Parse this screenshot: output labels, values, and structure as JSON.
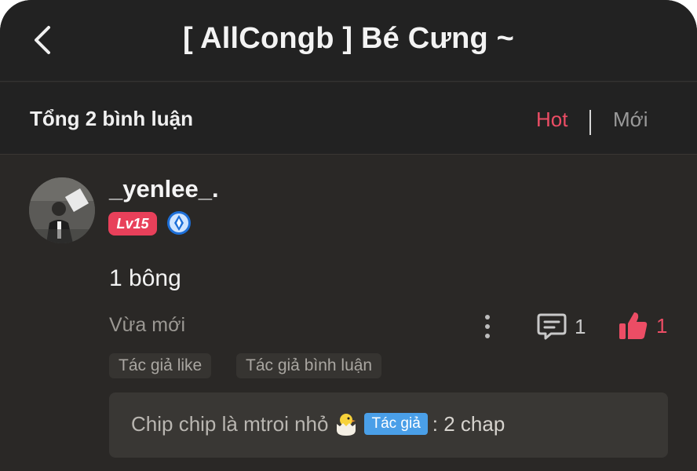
{
  "header": {
    "title": "[ AllCongb ] Bé Cưng ~",
    "back_icon": "chevron-left-icon"
  },
  "subbar": {
    "total_label": "Tổng 2 bình luận",
    "sort_hot": "Hot",
    "sort_new": "Mới",
    "active_sort": "Hot"
  },
  "comment": {
    "username": "_yenlee_.",
    "level": "Lv15",
    "rank_icon": "blue-diamond-rank-icon",
    "text": "1 bông",
    "time": "Vừa mới",
    "reply_count": "1",
    "like_count": "1",
    "tags": [
      "Tác giả like",
      "Tác giả bình luận"
    ],
    "reply": {
      "text": "Chip chip là mtroi nhỏ",
      "emoji_icon": "hatching-chick-icon",
      "author_badge": "Tác giả",
      "after": ": 2 chap"
    }
  },
  "colors": {
    "accent": "#ec4d65",
    "background": "#2a2826",
    "header_bg": "#222222",
    "author_badge": "#4a9fe8"
  }
}
